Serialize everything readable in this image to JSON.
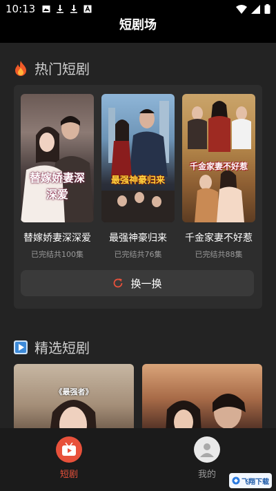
{
  "status_bar": {
    "time": "10:13"
  },
  "app": {
    "title": "短剧场"
  },
  "hot_section": {
    "title": "热门短剧",
    "dramas": [
      {
        "title": "替嫁娇妻深深爱",
        "meta": "已完结共100集",
        "poster_text": "替嫁娇妻深深爱"
      },
      {
        "title": "最强神豪归来",
        "meta": "已完结共76集",
        "poster_text": "最强神豪归来"
      },
      {
        "title": "千金家妻不好惹",
        "meta": "已完结共88集",
        "poster_text": "千金家妻不好惹"
      }
    ],
    "swap_label": "换一换"
  },
  "selected_section": {
    "title": "精选短剧",
    "cards": [
      {
        "poster_text": "《最强者》"
      },
      {
        "poster_text": ""
      }
    ]
  },
  "tabbar": {
    "tabs": [
      {
        "label": "短剧",
        "active": true
      },
      {
        "label": "我的",
        "active": false
      }
    ]
  },
  "watermark": {
    "text": "飞翔下载"
  },
  "colors": {
    "accent": "#e8513b",
    "background": "#232323",
    "panel": "#2d2d2d"
  }
}
